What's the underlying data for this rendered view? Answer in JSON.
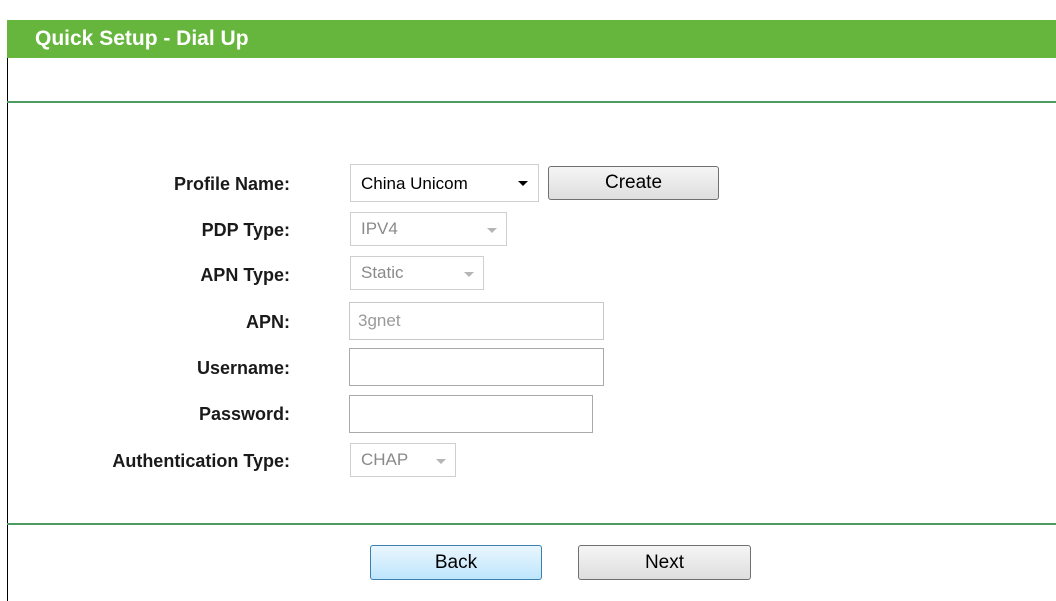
{
  "header": {
    "title": "Quick Setup - Dial Up"
  },
  "form": {
    "profile_name": {
      "label": "Profile Name:",
      "value": "China Unicom"
    },
    "create_button": "Create",
    "pdp_type": {
      "label": "PDP Type:",
      "value": "IPV4"
    },
    "apn_type": {
      "label": "APN Type:",
      "value": "Static"
    },
    "apn": {
      "label": "APN:",
      "value": "3gnet"
    },
    "username": {
      "label": "Username:",
      "value": ""
    },
    "password": {
      "label": "Password:",
      "value": ""
    },
    "auth_type": {
      "label": "Authentication Type:",
      "value": "CHAP"
    }
  },
  "footer": {
    "back_label": "Back",
    "next_label": "Next"
  },
  "colors": {
    "header_green": "#66b63d",
    "divider_green": "#4e9a63"
  }
}
